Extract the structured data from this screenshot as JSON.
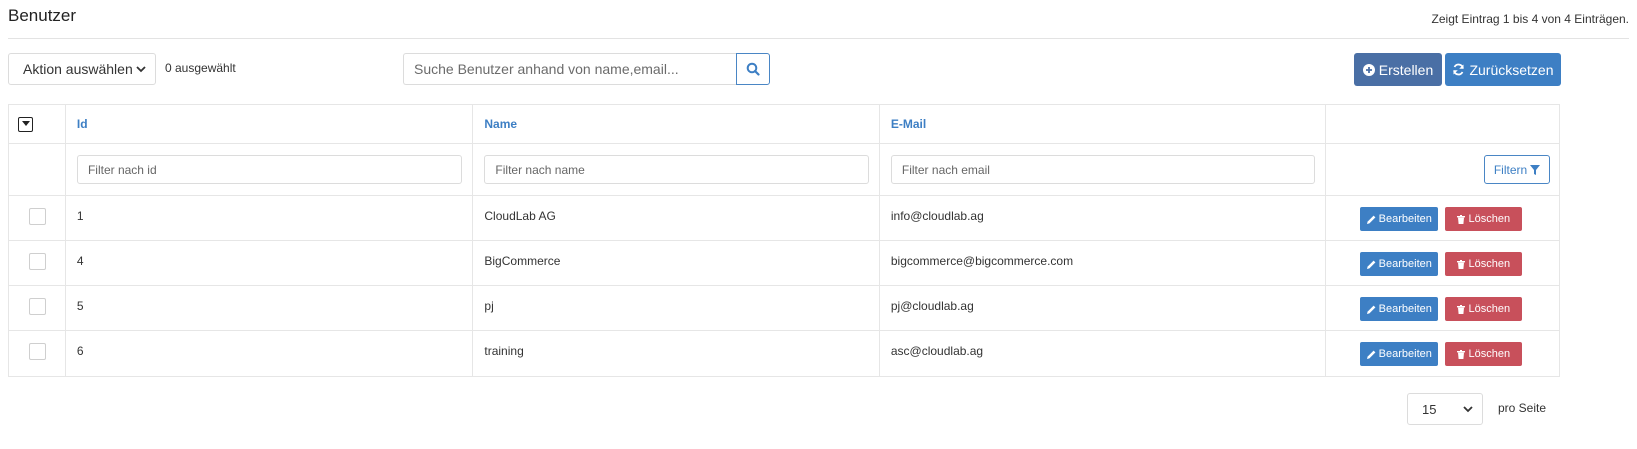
{
  "header": {
    "title": "Benutzer",
    "entry_info": "Zeigt Eintrag 1 bis 4 von 4 Einträgen."
  },
  "toolbar": {
    "action_select": "Aktion auswählen",
    "selected_count": "0 ausgewählt",
    "search_placeholder": "Suche Benutzer anhand von name,email...",
    "create_label": "Erstellen",
    "reset_label": "Zurücksetzen"
  },
  "table": {
    "columns": [
      "Id",
      "Name",
      "E-Mail"
    ],
    "filters": {
      "id_placeholder": "Filter nach id",
      "name_placeholder": "Filter nach name",
      "email_placeholder": "Filter nach email",
      "button_label": "Filtern"
    },
    "rows": [
      {
        "id": "1",
        "name": "CloudLab AG",
        "email": "info@cloudlab.ag"
      },
      {
        "id": "4",
        "name": "BigCommerce",
        "email": "bigcommerce@bigcommerce.com"
      },
      {
        "id": "5",
        "name": "pj",
        "email": "pj@cloudlab.ag"
      },
      {
        "id": "6",
        "name": "training",
        "email": "asc@cloudlab.ag"
      }
    ],
    "edit_label": "Bearbeiten",
    "delete_label": "Löschen"
  },
  "pagination": {
    "page_size": "15",
    "per_page_label": "pro Seite"
  },
  "colors": {
    "primary": "#3d7fc4",
    "create": "#4a6fa5",
    "danger": "#c8505b"
  },
  "icons": [
    "chevron-down-icon",
    "search-icon",
    "plus-circle-icon",
    "refresh-icon",
    "caret-down-icon",
    "filter-icon",
    "pencil-icon",
    "trash-icon"
  ]
}
